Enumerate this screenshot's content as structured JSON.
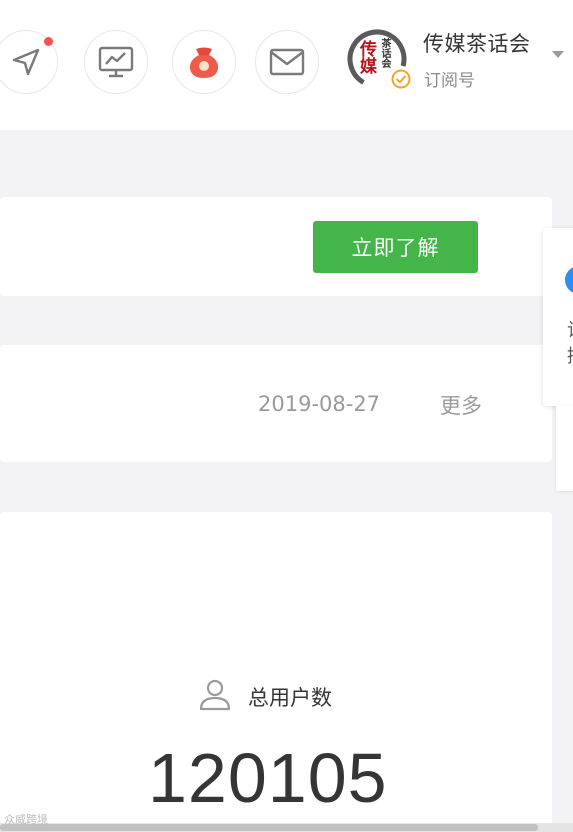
{
  "header": {
    "icons": [
      "send-icon",
      "analytics-icon",
      "red-envelope-icon",
      "mail-icon"
    ],
    "account": {
      "name": "传媒茶话会",
      "type": "订阅号",
      "avatar_text_main": "传媒",
      "avatar_text_sub": "茶话会"
    }
  },
  "banner": {
    "button_label": "立即了解"
  },
  "notice": {
    "date": "2019-08-27",
    "more_label": "更多"
  },
  "stats": {
    "label": "总用户数",
    "value": "120105"
  },
  "side_popup": {
    "text": "让接"
  },
  "watermark": {
    "text": "众威跨境"
  },
  "colors": {
    "accent_green": "#44b549",
    "notif_dot": "#fa5151",
    "verified": "#f4a527",
    "avatar_red": "#b0161d"
  }
}
